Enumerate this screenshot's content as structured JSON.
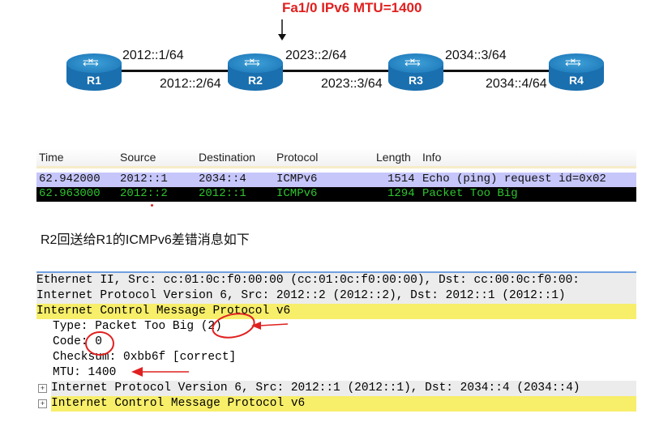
{
  "title": "Fa1/0 IPv6 MTU=1400",
  "routers": [
    "R1",
    "R2",
    "R3",
    "R4"
  ],
  "addresses": {
    "r1_r2_a": "2012::1/64",
    "r1_r2_b": "2012::2/64",
    "r2_r3_a": "2023::2/64",
    "r2_r3_b": "2023::3/64",
    "r3_r4_a": "2034::3/64",
    "r3_r4_b": "2034::4/64"
  },
  "packet_list": {
    "headers": [
      "Time",
      "Source",
      "Destination",
      "Protocol",
      "Length",
      "Info"
    ],
    "rows": [
      [
        "62.942000",
        "2012::1",
        "2034::4",
        "ICMPv6",
        "1514",
        "Echo (ping) request id=0x02"
      ],
      [
        "62.963000",
        "2012::2",
        "2012::1",
        "ICMPv6",
        "1294",
        "Packet Too Big"
      ]
    ]
  },
  "caption": "R2回送给R1的ICMPv6差错消息如下",
  "details": [
    "Ethernet II, Src: cc:01:0c:f0:00:00 (cc:01:0c:f0:00:00), Dst: cc:00:0c:f0:00:",
    "Internet Protocol Version 6, Src: 2012::2 (2012::2), Dst: 2012::1 (2012::1)",
    "Internet Control Message Protocol v6",
    "Type: Packet Too Big (2)",
    "Code: 0",
    "Checksum: 0xbb6f [correct]",
    "MTU: 1400",
    "Internet Protocol Version 6, Src: 2012::1 (2012::1), Dst: 2034::4 (2034::4)",
    "Internet Control Message Protocol v6"
  ],
  "colors": {
    "accent": "#e02020",
    "highlight": "#f7ee6a",
    "row_selected": "#c6c6fb",
    "router": "#1a6fae"
  }
}
